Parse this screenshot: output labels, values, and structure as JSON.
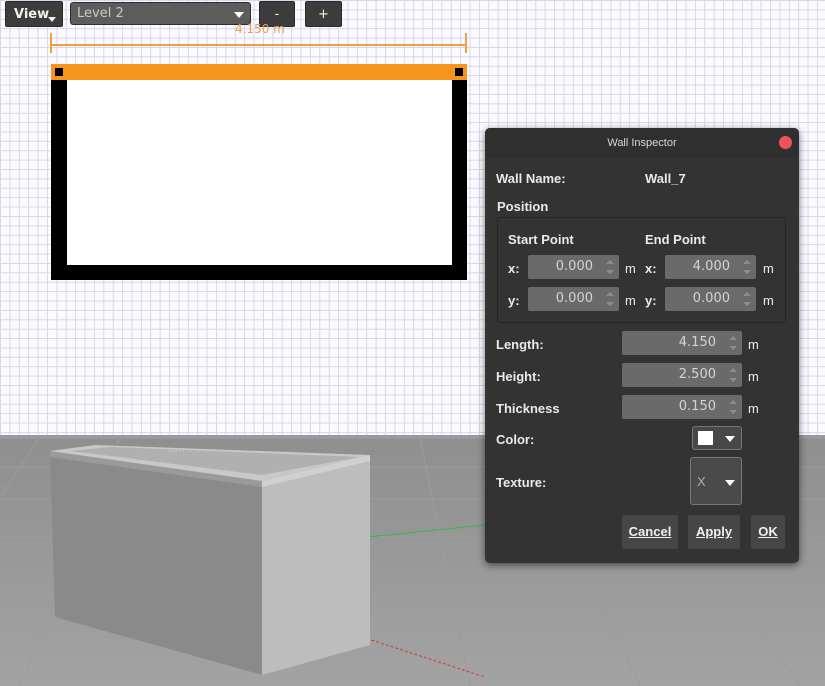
{
  "toolbar": {
    "view_label": "View",
    "level_value": "Level 2",
    "minus_label": "-",
    "plus_label": "+"
  },
  "plan": {
    "dimension_label": "4.150 m"
  },
  "dialog": {
    "title": "Wall Inspector",
    "wall_name_label": "Wall Name:",
    "wall_name_value": "Wall_7",
    "position_label": "Position",
    "start_point_label": "Start Point",
    "end_point_label": "End Point",
    "x_label": "x:",
    "y_label": "y:",
    "start_x": "0.000",
    "start_y": "0.000",
    "end_x": "4.000",
    "end_y": "0.000",
    "unit": "m",
    "length_label": "Length:",
    "length_value": "4.150",
    "height_label": "Height:",
    "height_value": "2.500",
    "thickness_label": "Thickness",
    "thickness_value": "0.150",
    "color_label": "Color:",
    "color_value": "#ffffff",
    "texture_label": "Texture:",
    "texture_value": "X",
    "cancel_label": "Cancel",
    "apply_label": "Apply",
    "ok_label": "OK"
  },
  "colors": {
    "selection": "#f7941d",
    "dimension": "#f0a040",
    "dialog_bg": "#333333",
    "close_button": "#f0525a"
  }
}
